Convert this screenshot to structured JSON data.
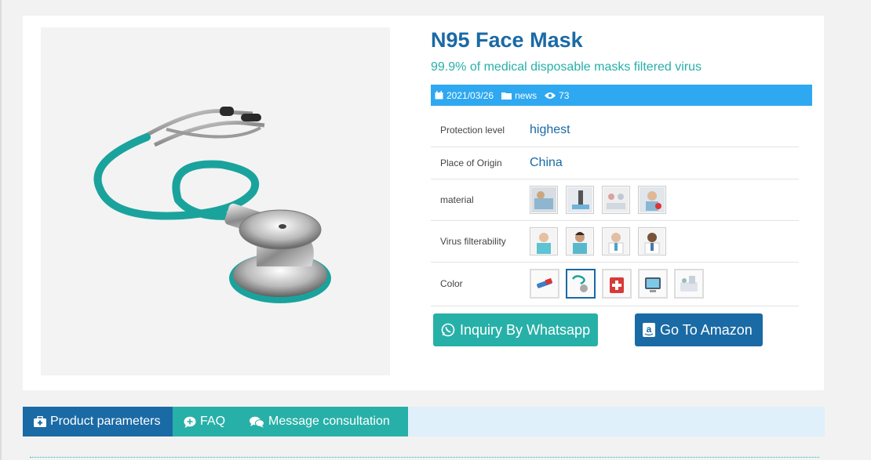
{
  "product": {
    "title": "N95 Face Mask",
    "subtitle": "99.9% of medical disposable masks filtered virus",
    "image_subject": "stethoscope"
  },
  "meta": {
    "date": "2021/03/26",
    "category": "news",
    "views": "73",
    "bar_color": "#2ea8f0"
  },
  "params": {
    "rows": [
      {
        "label": "Protection level",
        "value": "highest"
      },
      {
        "label": "Place of Origin",
        "value": "China"
      },
      {
        "label": "material",
        "thumbs": [
          "lab-scene-1",
          "lab-scene-2",
          "lab-scene-3",
          "lab-scene-4"
        ]
      },
      {
        "label": "Virus filterability",
        "thumbs": [
          "nurse-1",
          "nurse-2",
          "doctor-1",
          "doctor-2"
        ]
      },
      {
        "label": "Color",
        "thumbs": [
          "syringe",
          "stethoscope",
          "first-aid-kit",
          "monitor",
          "pills"
        ],
        "selected_index": 1
      }
    ]
  },
  "actions": {
    "whatsapp_label": "Inquiry By Whatsapp",
    "amazon_label": "Go To Amazon"
  },
  "tabs": [
    {
      "label": "Product parameters",
      "icon": "medkit-icon",
      "active": true
    },
    {
      "label": "FAQ",
      "icon": "chat-plus-icon"
    },
    {
      "label": "Message consultation",
      "icon": "comments-icon"
    }
  ],
  "colors": {
    "primary": "#1a6aa5",
    "accent": "#27b0a8"
  }
}
